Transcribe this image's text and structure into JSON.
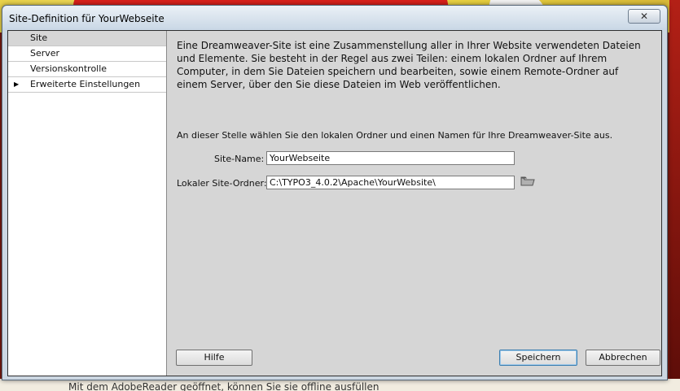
{
  "window": {
    "title": "Site-Definition für YourWebseite",
    "close_symbol": "✕"
  },
  "background": {
    "bottom_text": "Mit dem AdobeReader geöffnet, können Sie sie offline ausfüllen"
  },
  "sidebar": {
    "items": [
      {
        "label": "Site",
        "selected": true,
        "expandable": false
      },
      {
        "label": "Server",
        "selected": false,
        "expandable": false
      },
      {
        "label": "Versionskontrolle",
        "selected": false,
        "expandable": false
      },
      {
        "label": "Erweiterte Einstellungen",
        "selected": false,
        "expandable": true
      }
    ]
  },
  "main": {
    "intro": "Eine Dreamweaver-Site ist eine Zusammenstellung aller in Ihrer Website verwendeten Dateien und Elemente. Sie besteht in der Regel aus zwei Teilen: einem lokalen Ordner auf Ihrem Computer, in dem Sie Dateien speichern und bearbeiten, sowie einem Remote-Ordner auf einem Server, über den Sie diese Dateien im Web veröffentlichen.",
    "instruction": "An dieser Stelle wählen Sie den lokalen Ordner und einen Namen für Ihre Dreamweaver-Site aus.",
    "site_name_label": "Site-Name:",
    "site_name_value": "YourWebseite",
    "local_folder_label": "Lokaler Site-Ordner:",
    "local_folder_value": "C:\\TYPO3_4.0.2\\Apache\\YourWebsite\\",
    "folder_icon": "folder-icon"
  },
  "buttons": {
    "help": "Hilfe",
    "save": "Speichern",
    "cancel": "Abbrechen"
  }
}
